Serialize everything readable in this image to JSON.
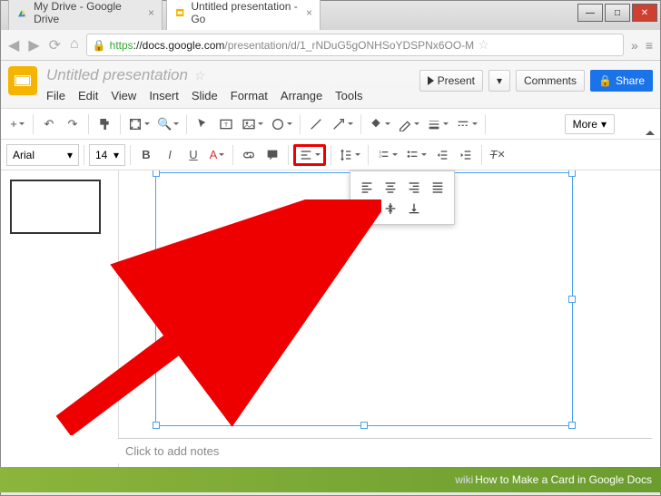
{
  "window": {
    "tabs": [
      {
        "label": "My Drive - Google Drive"
      },
      {
        "label": "Untitled presentation - Go"
      }
    ],
    "url_scheme": "https",
    "url_host": "://docs.google.com",
    "url_path": "/presentation/d/1_rNDuG5gONHSoYDSPNx6OO-M"
  },
  "doc": {
    "title": "Untitled presentation",
    "menus": [
      "File",
      "Edit",
      "View",
      "Insert",
      "Slide",
      "Format",
      "Arrange",
      "Tools"
    ],
    "present_label": "Present",
    "comments_label": "Comments",
    "share_label": "Share"
  },
  "toolbar": {
    "more_label": "More",
    "font": "Arial",
    "size": "14"
  },
  "notes_placeholder": "Click to add notes",
  "banner": {
    "prefix": "wiki",
    "text": "How to Make a Card in Google Docs"
  }
}
